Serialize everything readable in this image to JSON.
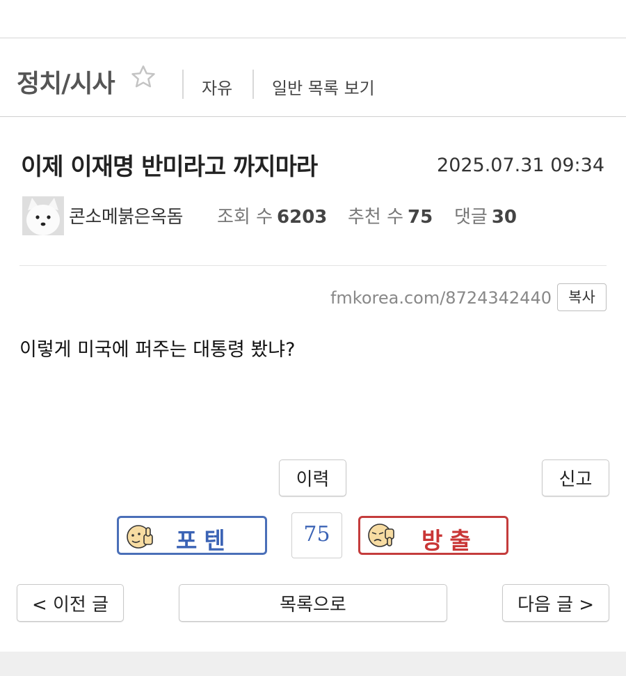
{
  "header": {
    "board_name": "정치/시사",
    "star_icon": "star-outline-icon",
    "link_free": "자유",
    "link_list": "일반 목록 보기"
  },
  "post": {
    "title": "이제 이재명 반미라고 까지마라",
    "datetime": "2025.07.31 09:34",
    "author": "콘소메붉은옥돔",
    "views_label": "조회 수",
    "views": "6203",
    "recommends_label": "추천 수",
    "recommends": "75",
    "comments_label": "댓글",
    "comments": "30",
    "short_url": "fmkorea.com/8724342440",
    "copy_label": "복사",
    "body": "이렇게 미국에 퍼주는 대통령 봤냐?"
  },
  "actions": {
    "history_label": "이력",
    "report_label": "신고",
    "upvote_label": "포텐",
    "score": "75",
    "downvote_label": "방출",
    "prev_label": "< 이전 글",
    "list_label": "목록으로",
    "next_label": "다음 글 >"
  },
  "colors": {
    "upvote": "#3b63b5",
    "downvote": "#c93636"
  }
}
